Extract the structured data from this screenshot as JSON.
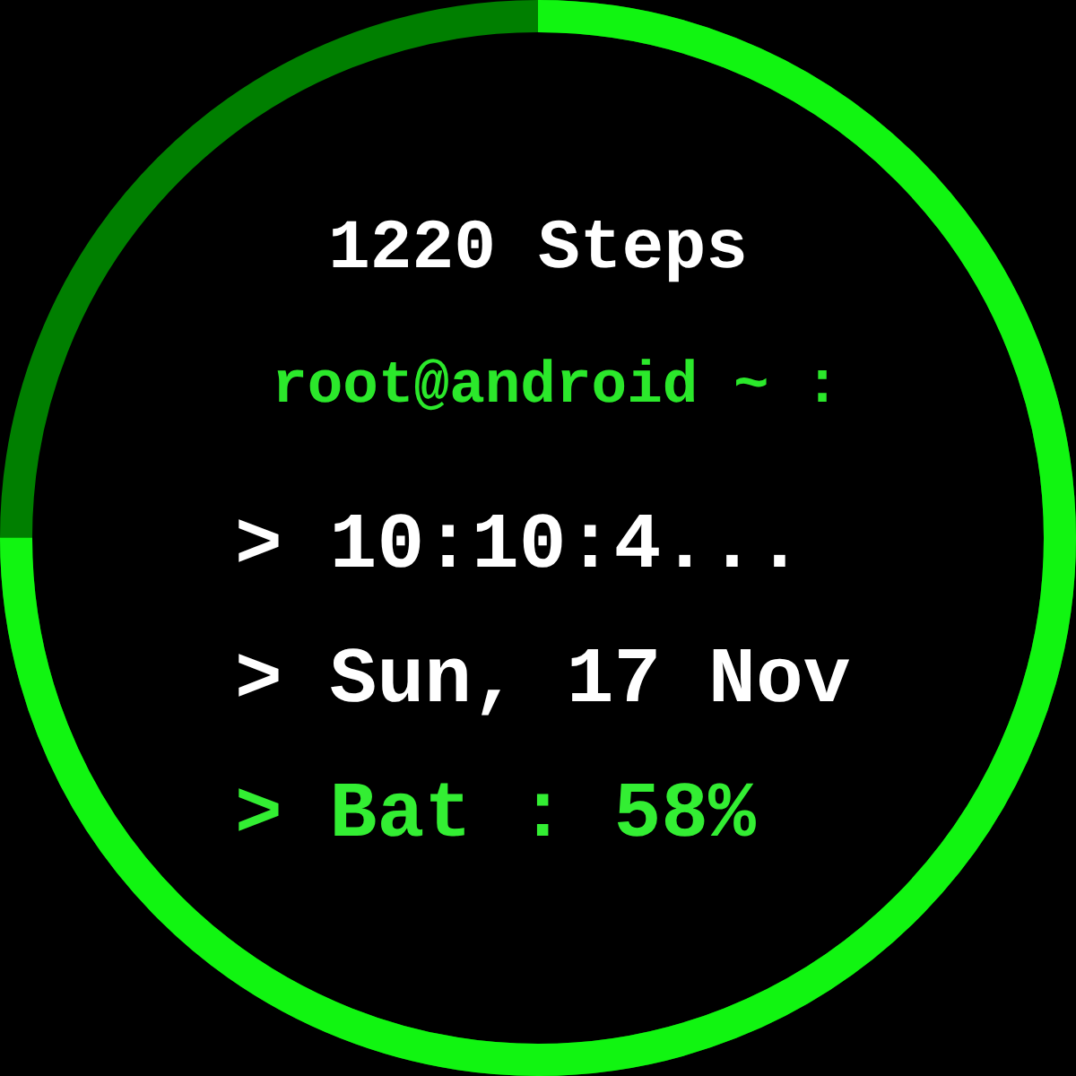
{
  "ring": {
    "level": 0.75
  },
  "steps": "1220 Steps",
  "prompt": "root@android ~ :",
  "lines": [
    {
      "text": "> 10:10:4...",
      "color": "#ffffff"
    },
    {
      "text": "> Sun, 17 Nov",
      "color": "#ffffff"
    },
    {
      "text": "> Bat : 58%",
      "color": "#33ee33"
    }
  ]
}
